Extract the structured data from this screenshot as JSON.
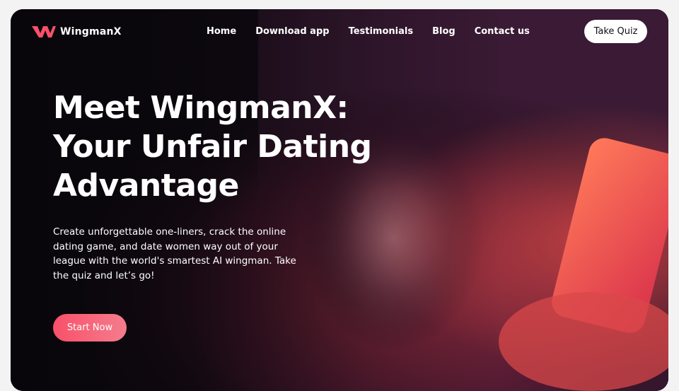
{
  "brand": {
    "name": "WingmanX",
    "accent": "#f9506a"
  },
  "nav": {
    "items": [
      "Home",
      "Download app",
      "Testimonials",
      "Blog",
      "Contact us"
    ],
    "cta": "Take Quiz"
  },
  "hero": {
    "headline_lines": [
      "Meet WingmanX:",
      "Your Unfair Dating",
      "Advantage"
    ],
    "subtext": "Create unforgettable one-liners, crack the online dating game, and date women way out of your league with the world's smartest AI wingman. Take the quiz and let’s go!",
    "cta": "Start Now"
  }
}
